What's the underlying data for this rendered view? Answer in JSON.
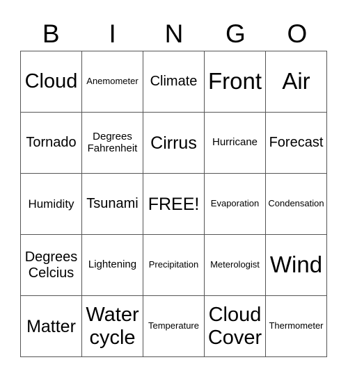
{
  "header": [
    "B",
    "I",
    "N",
    "G",
    "O"
  ],
  "cells": [
    [
      "Cloud",
      "Anemometer",
      "Climate",
      "Front",
      "Air"
    ],
    [
      "Tornado",
      "Degrees\nFahrenheit",
      "Cirrus",
      "Hurricane",
      "Forecast"
    ],
    [
      "Humidity",
      "Tsunami",
      "FREE!",
      "Evaporation",
      "Condensation"
    ],
    [
      "Degrees\nCelcius",
      "Lightening",
      "Precipitation",
      "Meterologist",
      "Wind"
    ],
    [
      "Matter",
      "Water\ncycle",
      "Temperature",
      "Cloud\nCover",
      "Thermometer"
    ]
  ]
}
